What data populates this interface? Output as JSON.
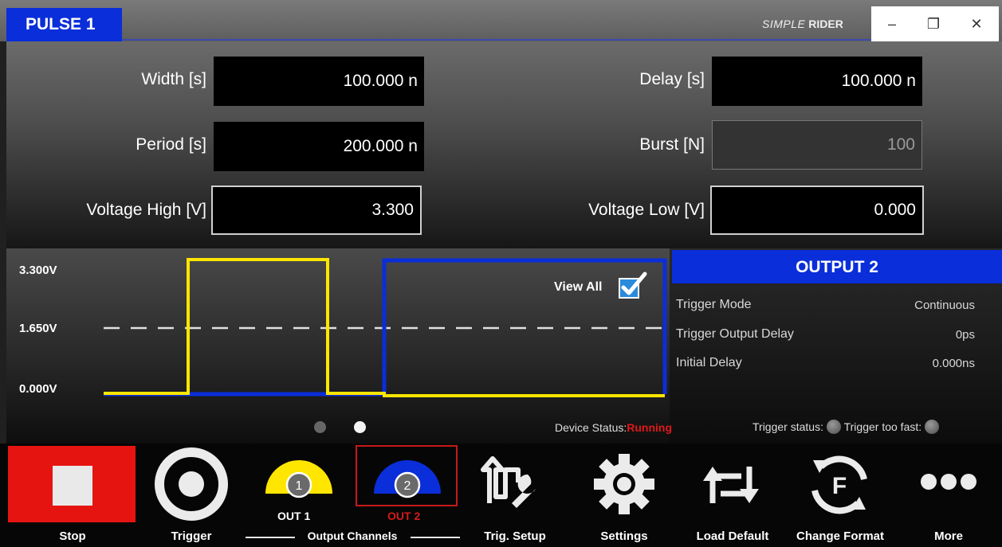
{
  "title_bar": {
    "tab": "PULSE 1",
    "brand_simple": "SIMPLE",
    "brand_rider": "RIDER",
    "minimize": "–",
    "restore": "❐",
    "close": "✕"
  },
  "params": {
    "width": {
      "label": "Width [s]",
      "value": "100.000 n"
    },
    "delay": {
      "label": "Delay [s]",
      "value": "100.000 n"
    },
    "period": {
      "label": "Period [s]",
      "value": "200.000 n"
    },
    "burst": {
      "label": "Burst [N]",
      "value": "100"
    },
    "voltage_high": {
      "label": "Voltage High [V]",
      "value": "3.300"
    },
    "voltage_low": {
      "label": "Voltage Low [V]",
      "value": "0.000"
    }
  },
  "waveform": {
    "level_high": "3.300V",
    "level_mid": "1.650V",
    "level_low": "0.000V",
    "view_all_label": "View All",
    "view_all_checked": true,
    "colors": {
      "out1": "#ffe600",
      "out2": "#0a2ed9",
      "mid_line": "#e0e0e0"
    }
  },
  "output_panel": {
    "title": "OUTPUT 2",
    "rows": [
      {
        "label": "Trigger Mode",
        "value": "Continuous"
      },
      {
        "label": "Trigger Output Delay",
        "value": "0ps"
      },
      {
        "label": "Initial Delay",
        "value": "0.000ns"
      }
    ]
  },
  "status": {
    "page_dots": {
      "count": 2,
      "active": 2
    },
    "device_status_label": "Device Status:",
    "device_status_value": "Running",
    "trigger_status_label": "Trigger status:",
    "trigger_too_fast_label": "Trigger too fast:"
  },
  "toolbar": {
    "stop": "Stop",
    "trigger": "Trigger",
    "out1": "OUT 1",
    "out1_num": "1",
    "out2": "OUT 2",
    "out2_num": "2",
    "output_channels": "Output Channels",
    "trig_setup": "Trig. Setup",
    "settings": "Settings",
    "load_default": "Load Default",
    "change_format": "Change Format",
    "change_format_letter": "F",
    "more": "More",
    "selected_output": 2
  },
  "colors": {
    "accent_blue": "#0a2ed9",
    "stop_red": "#e61410",
    "status_running": "#e01818",
    "out1_yellow": "#ffe600"
  }
}
